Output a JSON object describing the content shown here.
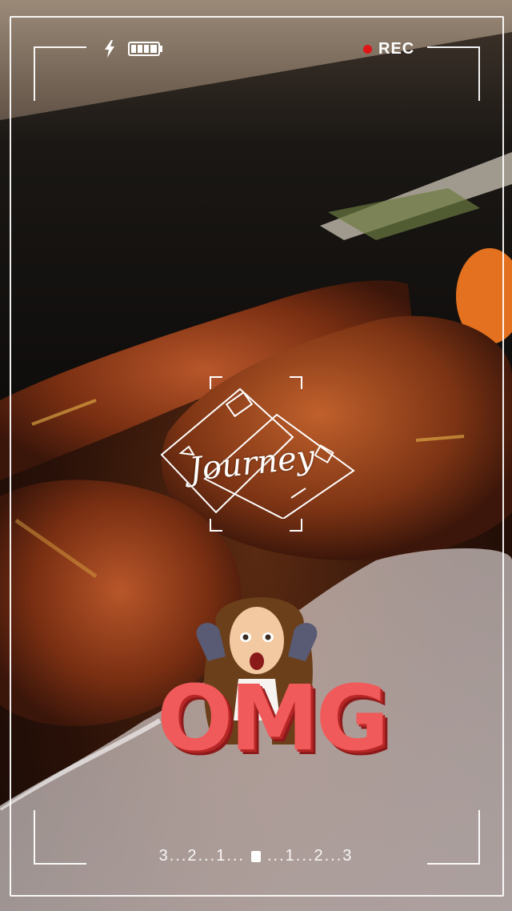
{
  "camera_ui": {
    "rec_label": "REC",
    "battery": "full-battery-icon",
    "flash": "flash-icon",
    "rec_color": "#e01515"
  },
  "stickers": {
    "journey": "Journey",
    "omg": "OMG"
  },
  "countdown": {
    "left": "3...2...1...",
    "right": "...1...2...3"
  }
}
